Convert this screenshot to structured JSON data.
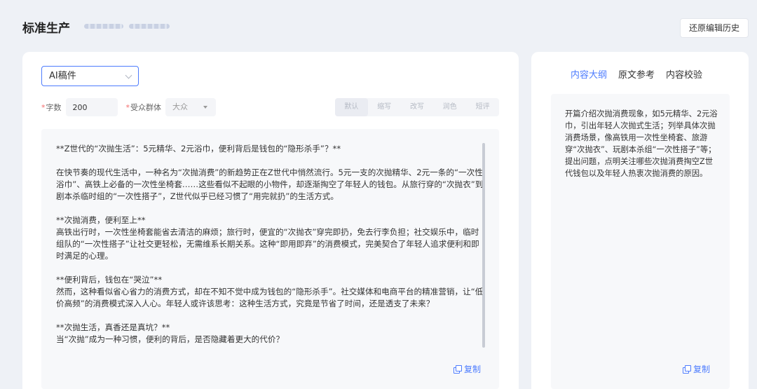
{
  "header": {
    "title": "标准生产",
    "history_button": "还原编辑历史"
  },
  "editor": {
    "type_select": "AI稿件",
    "word_count_label": "字数",
    "word_count_value": "200",
    "audience_label": "受众群体",
    "audience_value": "大众",
    "modes": [
      "默认",
      "缩写",
      "改写",
      "润色",
      "短评"
    ],
    "article": [
      "**Z世代的“次抛生活”：5元精华、2元浴巾，便利背后是钱包的“隐形杀手”？**",
      "在快节奏的现代生活中，一种名为“次抛消费”的新趋势正在Z世代中悄然流行。5元一支的次抛精华、2元一条的“一次性浴巾”、高铁上必备的一次性坐椅套……这些看似不起眼的小物件，却逐渐掏空了年轻人的钱包。从旅行穿的“次抛衣”到剧本杀临时组的“一次性搭子”，Z世代似乎已经习惯了“用完就扔”的生活方式。",
      "**次抛消费，便利至上**\n高铁出行时，一次性坐椅套能省去清洁的麻烦；旅行时，便宜的“次抛衣”穿完即扔，免去行李负担；社交娱乐中，临时组队的“一次性搭子”让社交更轻松，无需维系长期关系。这种“即用即弃”的消费模式，完美契合了年轻人追求便利和即时满足的心理。",
      "**便利背后，钱包在“哭泣”**\n然而，这种看似省心省力的消费方式，却在不知不觉中成为钱包的“隐形杀手”。社交媒体和电商平台的精准营销，让“低价高频”的消费模式深入人心。年轻人或许该思考：这种生活方式，究竟是节省了时间，还是透支了未来？",
      "**次抛生活，真香还是真坑？**\n当“次抛”成为一种习惯，便利的背后，是否隐藏着更大的代价？"
    ],
    "copy_label": "复制"
  },
  "sidebar": {
    "tabs": [
      "内容大纲",
      "原文参考",
      "内容校验"
    ],
    "active_tab": 0,
    "outline": "开篇介绍次抛消费现象，如5元精华、2元浴巾，引出年轻人次抛式生活；列举具体次抛消费场景，像高铁用一次性坐椅套、旅游穿“次抛衣”、玩剧本杀组“一次性搭子”等；提出问题，点明关注哪些次抛消费掏空Z世代钱包以及年轻人热衷次抛消费的原因。",
    "copy_label": "复制"
  },
  "colors": {
    "accent": "#4d7cfe",
    "background": "#eef1f6",
    "required": "#f56c6c"
  }
}
